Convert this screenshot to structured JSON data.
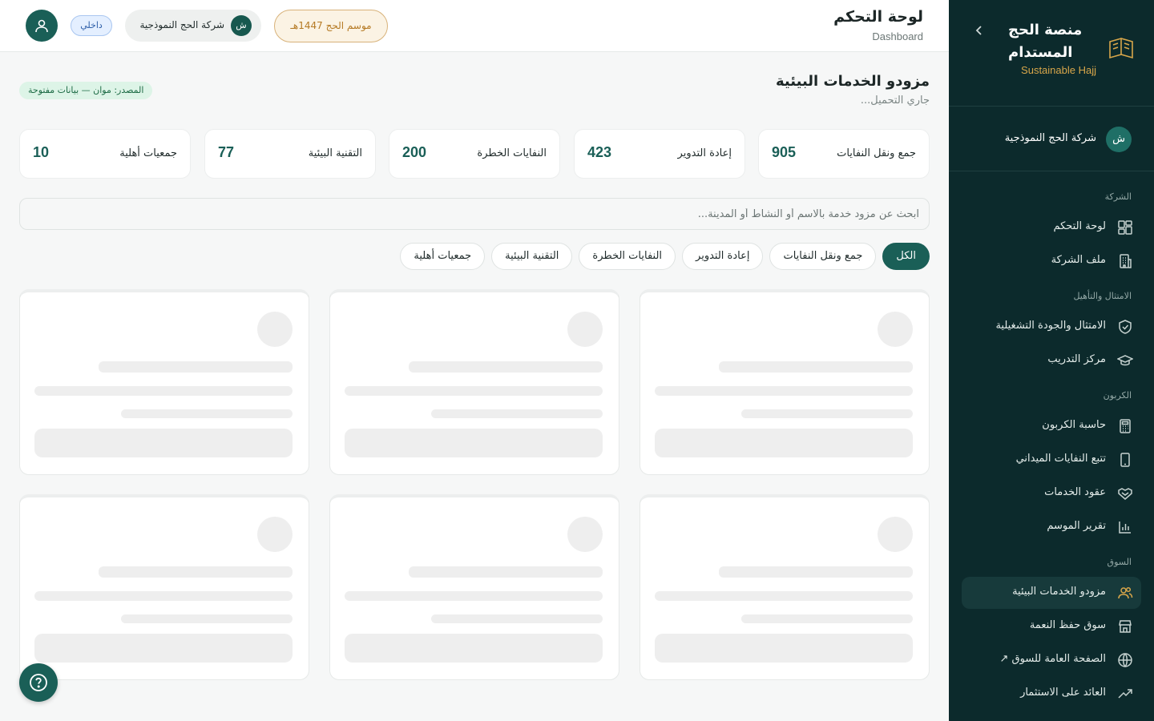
{
  "sidebar": {
    "brand_title": "منصة الحج المستدام",
    "brand_subtitle": "Sustainable Hajj",
    "company_avatar": "ش",
    "company_name": "شركة الحج النموذجية",
    "sections": [
      {
        "title": "الشركة",
        "items": [
          {
            "label": "لوحة التحكم",
            "icon": "dashboard-grid-icon"
          },
          {
            "label": "ملف الشركة",
            "icon": "building-icon"
          }
        ]
      },
      {
        "title": "الامتثال والتأهيل",
        "items": [
          {
            "label": "الامتثال والجودة التشغيلية",
            "icon": "shield-check-icon"
          },
          {
            "label": "مركز التدريب",
            "icon": "graduation-cap-icon"
          }
        ]
      },
      {
        "title": "الكربون",
        "items": [
          {
            "label": "حاسبة الكربون",
            "icon": "calculator-icon"
          },
          {
            "label": "تتبع النفايات الميداني",
            "icon": "mobile-device-icon"
          },
          {
            "label": "عقود الخدمات",
            "icon": "handshake-icon"
          },
          {
            "label": "تقرير الموسم",
            "icon": "bar-chart-icon"
          }
        ]
      },
      {
        "title": "السوق",
        "items": [
          {
            "label": "مزودو الخدمات البيئية",
            "icon": "users-icon",
            "active": true
          },
          {
            "label": "سوق حفظ النعمة",
            "icon": "store-icon"
          },
          {
            "label": "الصفحة العامة للسوق ↗",
            "icon": "globe-icon"
          },
          {
            "label": "العائد على الاستثمار",
            "icon": "trending-up-icon"
          }
        ]
      }
    ]
  },
  "header": {
    "title": "لوحة التحكم",
    "subtitle": "Dashboard",
    "season": "موسم الحج 1447هـ",
    "company_avatar": "ش",
    "company_name": "شركة الحج النموذجية",
    "role_badge": "داخلي"
  },
  "main": {
    "title": "مزودو الخدمات البيئية",
    "subtitle": "جاري التحميل...",
    "source_badge": "المصدر: موان — بيانات مفتوحة",
    "stats": [
      {
        "label": "جمع ونقل النفايات",
        "value": "905"
      },
      {
        "label": "إعادة التدوير",
        "value": "423"
      },
      {
        "label": "النفايات الخطرة",
        "value": "200"
      },
      {
        "label": "التقنية البيئية",
        "value": "77"
      },
      {
        "label": "جمعيات أهلية",
        "value": "10"
      }
    ],
    "search_placeholder": "ابحث عن مزود خدمة بالاسم أو النشاط أو المدينة...",
    "filters": [
      "الكل",
      "جمع ونقل النفايات",
      "إعادة التدوير",
      "النفايات الخطرة",
      "التقنية البيئية",
      "جمعيات أهلية"
    ],
    "active_filter": "الكل"
  },
  "colors": {
    "sidebar_bg": "#0c2a2c",
    "primary": "#1a5f57",
    "accent_gold": "#d8a64a"
  }
}
